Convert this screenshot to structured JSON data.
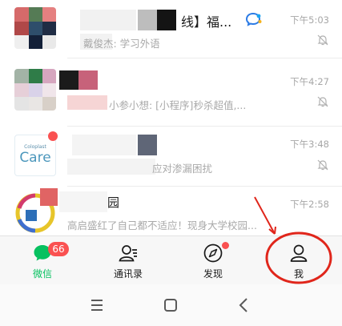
{
  "chats": [
    {
      "name": "线】福...",
      "preview": "戴俊杰: 学习外语",
      "time": "下午5:03"
    },
    {
      "name": "",
      "preview": "小参小想: [小程序]秒杀超值,...",
      "time": "下午4:27"
    },
    {
      "name": "",
      "preview": "应对渗漏困扰",
      "time": "下午3:48",
      "avatar_text": {
        "brand": "Coloplast",
        "care": "Care"
      }
    },
    {
      "name": "园",
      "preview": "高启盛红了自己都不适应！现身大学校园...",
      "time": "下午2:58"
    }
  ],
  "tabbar": {
    "wechat": {
      "label": "微信",
      "badge": "66"
    },
    "contacts": {
      "label": "通讯录"
    },
    "discover": {
      "label": "发现"
    },
    "me": {
      "label": "我"
    }
  },
  "colors": {
    "wechat_green": "#07c160",
    "badge_red": "#fa5151",
    "annotation_red": "#e0261b"
  }
}
